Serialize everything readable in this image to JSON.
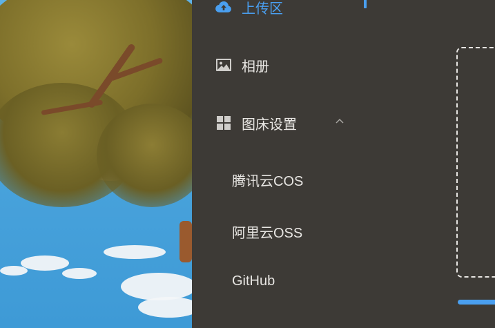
{
  "menu": {
    "upload": {
      "label": "上传区",
      "icon": "cloud-upload-icon",
      "active": true
    },
    "album": {
      "label": "相册",
      "icon": "image-icon"
    },
    "hosting_settings": {
      "label": "图床设置",
      "icon": "grid-icon",
      "expanded": true,
      "sub_items": [
        {
          "label": "腾讯云COS"
        },
        {
          "label": "阿里云OSS"
        },
        {
          "label": "GitHub"
        }
      ]
    }
  },
  "colors": {
    "accent": "#4a9ff0",
    "sidebar_bg": "#3d3a36",
    "text": "#e8e6e3"
  }
}
